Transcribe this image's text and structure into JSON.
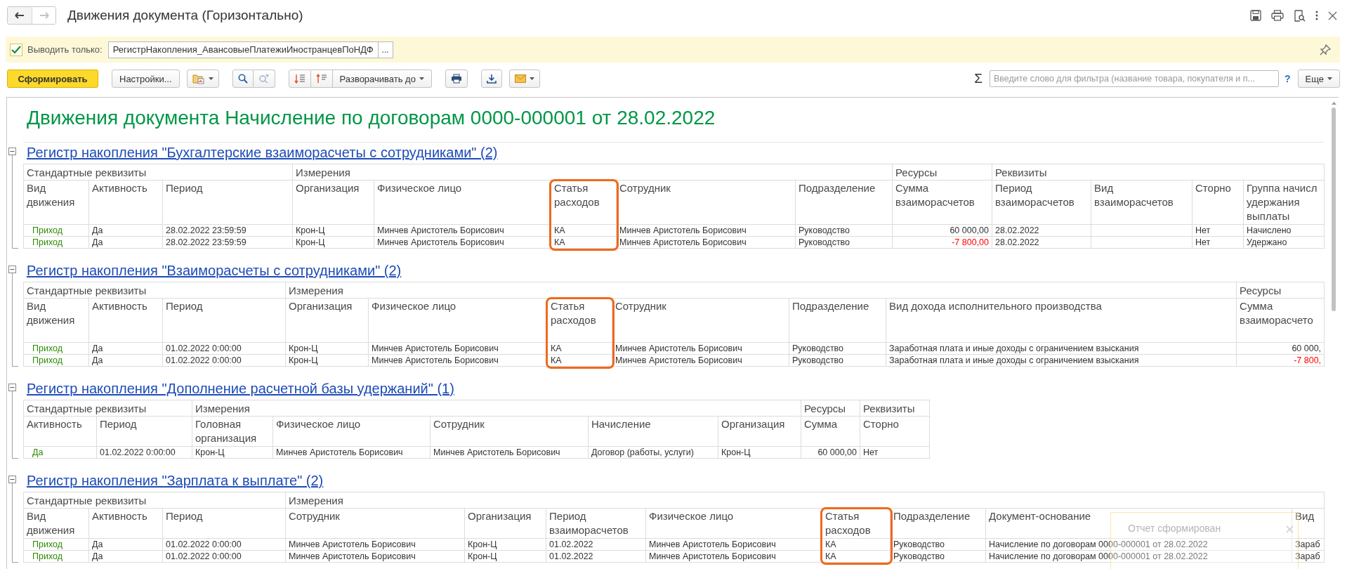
{
  "window": {
    "title": "Движения документа (Горизонтально)"
  },
  "filter_bar": {
    "checked": true,
    "label": "Выводить только:",
    "value": "РегистрНакопления_АвансовыеПлатежиИностранцевПоНДФ",
    "select_button": "..."
  },
  "toolbar": {
    "generate_button": "Сформировать",
    "settings_button": "Настройки...",
    "expand_button": "Разворачивать до",
    "sum_symbol": "Σ",
    "search": {
      "placeholder": "Введите слово для фильтра (название товара, покупателя и п..."
    },
    "help": "?",
    "more_button": "Еще"
  },
  "report": {
    "title": "Движения документа Начисление по договорам 0000-000001 от 28.02.2022",
    "registers": [
      {
        "title": "Регистр накопления \"Бухгалтерские взаиморасчеты с сотрудниками\" (2)",
        "expanded": true,
        "groups": [
          {
            "label": "Стандартные реквизиты"
          },
          {
            "label": "Измерения"
          },
          {
            "label": "Ресурсы"
          },
          {
            "label": "Реквизиты"
          }
        ],
        "columns": [
          {
            "label": "Вид движения",
            "kind": "movement",
            "highlighted": false
          },
          {
            "label": "Активность",
            "kind": "text",
            "highlighted": false
          },
          {
            "label": "Период",
            "kind": "text",
            "highlighted": false
          },
          {
            "label": "Организация",
            "kind": "text",
            "highlighted": false
          },
          {
            "label": "Физическое лицо",
            "kind": "text",
            "highlighted": false
          },
          {
            "label": "Статья расходов",
            "kind": "text",
            "highlighted": true
          },
          {
            "label": "Сотрудник",
            "kind": "text",
            "highlighted": false
          },
          {
            "label": "Подразделение",
            "kind": "text",
            "highlighted": false
          },
          {
            "label": "Сумма взаиморасчетов",
            "kind": "amount",
            "highlighted": false
          },
          {
            "label": "Период взаиморасчетов",
            "kind": "text",
            "highlighted": false
          },
          {
            "label": "Вид взаиморасчетов",
            "kind": "text",
            "highlighted": false
          },
          {
            "label": "Сторно",
            "kind": "text",
            "highlighted": false
          },
          {
            "label": "Группа начисл удержания выплаты",
            "kind": "text",
            "highlighted": false
          }
        ],
        "rows": [
          {
            "negative": false,
            "cells": [
              "Приход",
              "Да",
              "28.02.2022 23:59:59",
              "Крон-Ц",
              "Минчев Аристотель Борисович",
              "КА",
              "Минчев Аристотель Борисович",
              "Руководство",
              "60 000,00",
              "28.02.2022",
              null,
              "Нет",
              "Начислено"
            ]
          },
          {
            "negative": true,
            "cells": [
              "Приход",
              "Да",
              "28.02.2022 23:59:59",
              "Крон-Ц",
              "Минчев Аристотель Борисович",
              "КА",
              "Минчев Аристотель Борисович",
              "Руководство",
              "-7 800,00",
              "28.02.2022",
              null,
              "Нет",
              "Удержано"
            ]
          }
        ]
      },
      {
        "title": "Регистр накопления \"Взаиморасчеты с сотрудниками\" (2)",
        "expanded": true,
        "groups": [
          {
            "label": "Стандартные реквизиты"
          },
          {
            "label": "Измерения"
          },
          {
            "label": "Ресурсы"
          }
        ],
        "columns": [
          {
            "label": "Вид движения",
            "kind": "movement",
            "highlighted": false
          },
          {
            "label": "Активность",
            "kind": "text",
            "highlighted": false
          },
          {
            "label": "Период",
            "kind": "text",
            "highlighted": false
          },
          {
            "label": "Организация",
            "kind": "text",
            "highlighted": false
          },
          {
            "label": "Физическое лицо",
            "kind": "text",
            "highlighted": false
          },
          {
            "label": "Статья расходов",
            "kind": "text",
            "highlighted": true
          },
          {
            "label": "Сотрудник",
            "kind": "text",
            "highlighted": false
          },
          {
            "label": "Подразделение",
            "kind": "text",
            "highlighted": false
          },
          {
            "label": "Вид дохода исполнительного производства",
            "kind": "text",
            "highlighted": false
          },
          {
            "label": "Сумма взаиморасчето",
            "kind": "amount",
            "highlighted": false
          }
        ],
        "rows": [
          {
            "negative": false,
            "cells": [
              "Приход",
              "Да",
              "01.02.2022 0:00:00",
              "Крон-Ц",
              "Минчев Аристотель Борисович",
              "КА",
              "Минчев Аристотель Борисович",
              "Руководство",
              "Заработная плата и иные доходы с ограничением взыскания",
              "60 000,"
            ]
          },
          {
            "negative": true,
            "cells": [
              "Приход",
              "Да",
              "01.02.2022 0:00:00",
              "Крон-Ц",
              "Минчев Аристотель Борисович",
              "КА",
              "Минчев Аристотель Борисович",
              "Руководство",
              "Заработная плата и иные доходы с ограничением взыскания",
              "-7 800,"
            ]
          }
        ]
      },
      {
        "title": "Регистр накопления \"Дополнение расчетной базы удержаний\" (1)",
        "expanded": true,
        "groups": [
          {
            "label": "Стандартные реквизиты"
          },
          {
            "label": "Измерения"
          },
          {
            "label": "Ресурсы"
          },
          {
            "label": "Реквизиты"
          }
        ],
        "columns": [
          {
            "label": "Активность",
            "kind": "movement",
            "highlighted": false
          },
          {
            "label": "Период",
            "kind": "text",
            "highlighted": false
          },
          {
            "label": "Головная организация",
            "kind": "text",
            "highlighted": false
          },
          {
            "label": "Физическое лицо",
            "kind": "text",
            "highlighted": false
          },
          {
            "label": "Сотрудник",
            "kind": "text",
            "highlighted": false
          },
          {
            "label": "Начисление",
            "kind": "text",
            "highlighted": false
          },
          {
            "label": "Организация",
            "kind": "text",
            "highlighted": false
          },
          {
            "label": "Сумма",
            "kind": "amount",
            "highlighted": false
          },
          {
            "label": "Сторно",
            "kind": "text",
            "highlighted": false
          }
        ],
        "rows": [
          {
            "negative": false,
            "cells": [
              "Да",
              "01.02.2022 0:00:00",
              "Крон-Ц",
              "Минчев Аристотель Борисович",
              "Минчев Аристотель Борисович",
              "Договор (работы, услуги)",
              "Крон-Ц",
              "60 000,00",
              "Нет"
            ]
          }
        ]
      },
      {
        "title": "Регистр накопления \"Зарплата к выплате\" (2)",
        "expanded": true,
        "groups": [
          {
            "label": "Стандартные реквизиты"
          },
          {
            "label": "Измерения"
          }
        ],
        "columns": [
          {
            "label": "Вид движения",
            "kind": "movement",
            "highlighted": false
          },
          {
            "label": "Активность",
            "kind": "text",
            "highlighted": false
          },
          {
            "label": "Период",
            "kind": "text",
            "highlighted": false
          },
          {
            "label": "Сотрудник",
            "kind": "text",
            "highlighted": false
          },
          {
            "label": "Организация",
            "kind": "text",
            "highlighted": false
          },
          {
            "label": "Период взаиморасчетов",
            "kind": "text",
            "highlighted": false
          },
          {
            "label": "Физическое лицо",
            "kind": "text",
            "highlighted": false
          },
          {
            "label": "Статья расходов",
            "kind": "text",
            "highlighted": true
          },
          {
            "label": "Подразделение",
            "kind": "text",
            "highlighted": false
          },
          {
            "label": "Документ-основание",
            "kind": "text",
            "highlighted": false
          },
          {
            "label": "Вид",
            "kind": "text",
            "highlighted": false
          }
        ],
        "rows": [
          {
            "cells": [
              "Приход",
              "Да",
              "01.02.2022 0:00:00",
              "Минчев Аристотель Борисович",
              "Крон-Ц",
              "01.02.2022",
              "Минчев Аристотель Борисович",
              "КА",
              "Руководство",
              "Начисление по договорам 0000-000001 от 28.02.2022",
              "Зараб"
            ]
          },
          {
            "cells": [
              "Приход",
              "Да",
              "01.02.2022 0:00:00",
              "Минчев Аристотель Борисович",
              "Крон-Ц",
              "01.02.2022",
              "Минчев Аристотель Борисович",
              "КА",
              "Руководство",
              "Начисление по договорам 0000-000001 от 28.02.2022",
              "Зараб"
            ]
          }
        ]
      }
    ]
  },
  "notification": {
    "text": "Отчет сформирован"
  }
}
